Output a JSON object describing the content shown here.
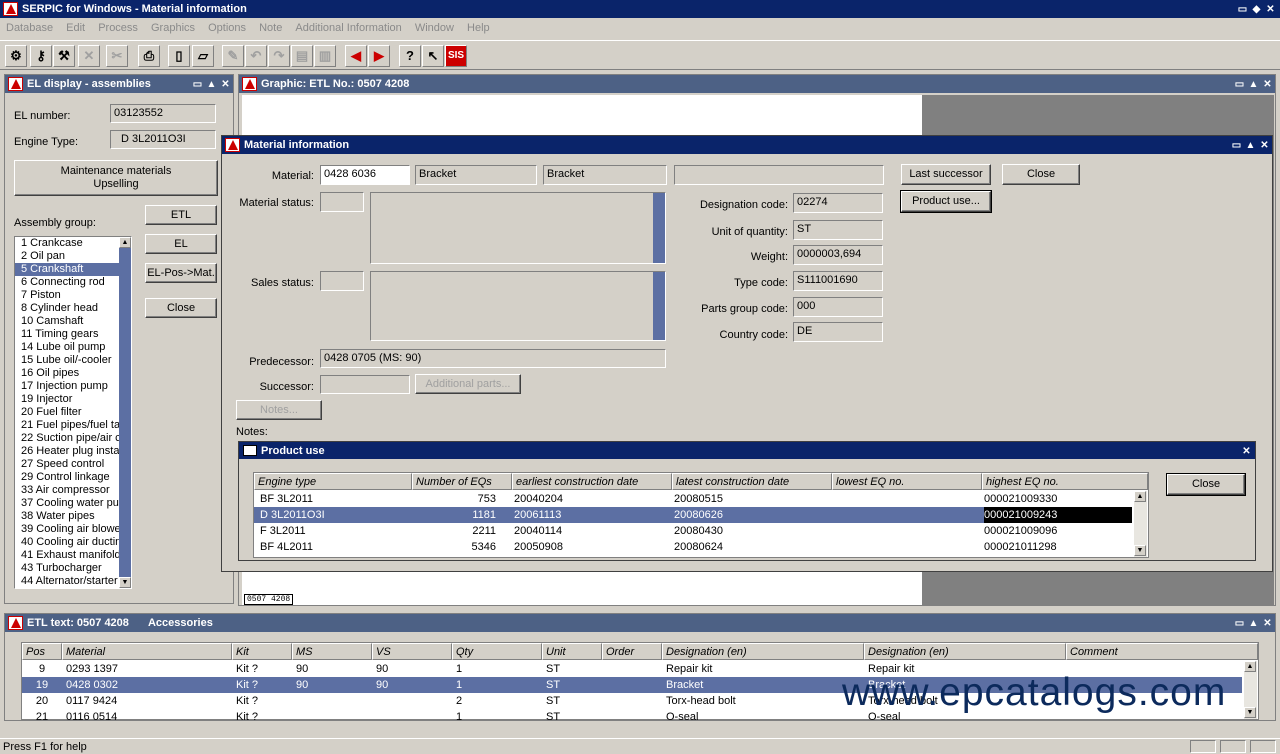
{
  "app": {
    "title": "SERPIC for Windows - Material information"
  },
  "menu": [
    "Database",
    "Edit",
    "Process",
    "Graphics",
    "Options",
    "Note",
    "Additional Information",
    "Window",
    "Help"
  ],
  "toolbar": {
    "icons": [
      "tools-icon",
      "key-icon",
      "wrench-icon",
      "cross-icon",
      "scissors-icon",
      "printer-icon",
      "new-file-icon",
      "open-folder-icon",
      "pen-icon",
      "undo-icon",
      "redo-icon",
      "window-icon",
      "window2-icon",
      "arrow-left-icon",
      "arrow-right-icon",
      "question-icon",
      "help-pointer-icon",
      "sis-icon"
    ],
    "sis": "SIS"
  },
  "el_panel": {
    "title": "EL display - assemblies",
    "el_number_label": "EL number:",
    "el_number": "03123552",
    "engine_type_label": "Engine Type:",
    "engine_type": "D 3L2011O3I",
    "maint_line1": "Maintenance materials",
    "maint_line2": "Upselling",
    "assembly_label": "Assembly group:",
    "btn_etl": "ETL",
    "btn_el": "EL",
    "btn_elpos": "EL-Pos->Mat.",
    "btn_close": "Close",
    "groups": [
      "1 Crankcase",
      "2 Oil pan",
      "5 Crankshaft",
      "6 Connecting rod",
      "7 Piston",
      "8 Cylinder head",
      "10 Camshaft",
      "11 Timing gears",
      "14 Lube oil pump",
      "15 Lube oil/-cooler",
      "16 Oil pipes",
      "17 Injection pump",
      "19 Injector",
      "20 Fuel filter",
      "21 Fuel pipes/fuel ta",
      "22 Suction pipe/air c",
      "26 Heater plug instal",
      "27 Speed control",
      "29 Control linkage",
      "33 Air compressor",
      "37 Cooling water pur",
      "38 Water pipes",
      "39 Cooling air blower",
      "40 Cooling air ductin",
      "41 Exhaust manifold",
      "43 Turbocharger",
      "44 Alternator/starter"
    ],
    "selected_index": 2
  },
  "graphic": {
    "title": "Graphic: ETL No.: 0507 4208",
    "tag": "0507 4208"
  },
  "material_info": {
    "title": "Material information",
    "material_label": "Material:",
    "material": "0428 6036",
    "desc1": "Bracket",
    "desc2": "Bracket",
    "desc3": "",
    "material_status_label": "Material status:",
    "sales_status_label": "Sales status:",
    "predecessor_label": "Predecessor:",
    "predecessor": "0428 0705 (MS: 90)",
    "successor_label": "Successor:",
    "additional_parts": "Additional parts...",
    "notes_btn": "Notes...",
    "notes_label": "Notes:",
    "last_successor": "Last successor",
    "close": "Close",
    "product_use_btn": "Product use...",
    "designation_code_label": "Designation code:",
    "designation_code": "02274",
    "unit_label": "Unit of quantity:",
    "unit": "ST",
    "weight_label": "Weight:",
    "weight": "0000003,694",
    "type_code_label": "Type code:",
    "type_code": "S111001690",
    "parts_group_label": "Parts group code:",
    "parts_group": "000",
    "country_label": "Country code:",
    "country": "DE"
  },
  "product_use": {
    "title": "Product use",
    "close": "Close",
    "columns": [
      "Engine type",
      "Number of EQs",
      "earliest construction date",
      "latest construction date",
      "lowest EQ no.",
      "highest EQ no."
    ],
    "rows": [
      {
        "engine": "BF 3L2011",
        "eqs": "753",
        "earliest": "20040204",
        "latest": "20080515",
        "lowest": "",
        "highest": "000021009330"
      },
      {
        "engine": "D 3L2011O3I",
        "eqs": "1181",
        "earliest": "20061113",
        "latest": "20080626",
        "lowest": "",
        "highest": "000021009243"
      },
      {
        "engine": "F 3L2011",
        "eqs": "2211",
        "earliest": "20040114",
        "latest": "20080430",
        "lowest": "",
        "highest": "000021009096"
      },
      {
        "engine": "BF 4L2011",
        "eqs": "5346",
        "earliest": "20050908",
        "latest": "20080624",
        "lowest": "",
        "highest": "000021011298"
      }
    ]
  },
  "etl": {
    "title": "ETL text: 0507 4208",
    "subtitle": "Accessories",
    "columns": [
      "Pos",
      "Material",
      "Kit",
      "MS",
      "VS",
      "Qty",
      "Unit",
      "Order",
      "Designation (en)",
      "Designation (en)",
      "Comment"
    ],
    "rows": [
      {
        "pos": "9",
        "material": "0293 1397",
        "kit": "Kit ?",
        "ms": "90",
        "vs": "90",
        "qty": "1",
        "unit": "ST",
        "order": "",
        "des1": "Repair kit",
        "des2": "Repair kit",
        "comment": ""
      },
      {
        "pos": "19",
        "material": "0428 0302",
        "kit": "Kit ?",
        "ms": "90",
        "vs": "90",
        "qty": "1",
        "unit": "ST",
        "order": "",
        "des1": "Bracket",
        "des2": "Bracket",
        "comment": ""
      },
      {
        "pos": "20",
        "material": "0117 9424",
        "kit": "Kit ?",
        "ms": "",
        "vs": "",
        "qty": "2",
        "unit": "ST",
        "order": "",
        "des1": "Torx-head bolt",
        "des2": "Torx-head bolt",
        "comment": ""
      },
      {
        "pos": "21",
        "material": "0116 0514",
        "kit": "Kit ?",
        "ms": "",
        "vs": "",
        "qty": "1",
        "unit": "ST",
        "order": "",
        "des1": "O-seal",
        "des2": "O-seal",
        "comment": ""
      }
    ]
  },
  "status": {
    "text": "Press F1 for help"
  },
  "watermark": "www.epcatalogs.com",
  "colors": {
    "title_active": "#0a246a",
    "title_inactive": "#4d6185",
    "selection": "#5c6fa3",
    "face": "#d4d0c8"
  }
}
